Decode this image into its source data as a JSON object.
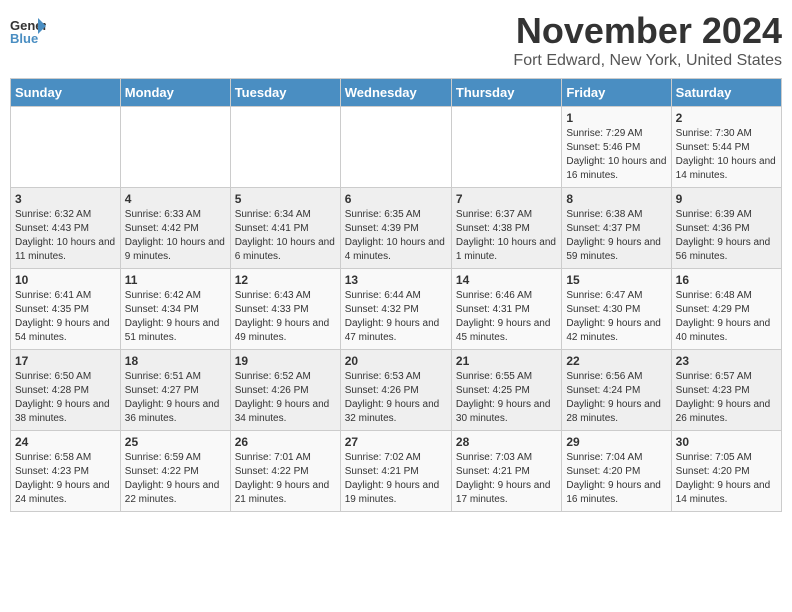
{
  "logo": {
    "line1": "General",
    "line2": "Blue"
  },
  "title": "November 2024",
  "location": "Fort Edward, New York, United States",
  "days_of_week": [
    "Sunday",
    "Monday",
    "Tuesday",
    "Wednesday",
    "Thursday",
    "Friday",
    "Saturday"
  ],
  "weeks": [
    [
      {
        "day": "",
        "info": ""
      },
      {
        "day": "",
        "info": ""
      },
      {
        "day": "",
        "info": ""
      },
      {
        "day": "",
        "info": ""
      },
      {
        "day": "",
        "info": ""
      },
      {
        "day": "1",
        "info": "Sunrise: 7:29 AM\nSunset: 5:46 PM\nDaylight: 10 hours and 16 minutes."
      },
      {
        "day": "2",
        "info": "Sunrise: 7:30 AM\nSunset: 5:44 PM\nDaylight: 10 hours and 14 minutes."
      }
    ],
    [
      {
        "day": "3",
        "info": "Sunrise: 6:32 AM\nSunset: 4:43 PM\nDaylight: 10 hours and 11 minutes."
      },
      {
        "day": "4",
        "info": "Sunrise: 6:33 AM\nSunset: 4:42 PM\nDaylight: 10 hours and 9 minutes."
      },
      {
        "day": "5",
        "info": "Sunrise: 6:34 AM\nSunset: 4:41 PM\nDaylight: 10 hours and 6 minutes."
      },
      {
        "day": "6",
        "info": "Sunrise: 6:35 AM\nSunset: 4:39 PM\nDaylight: 10 hours and 4 minutes."
      },
      {
        "day": "7",
        "info": "Sunrise: 6:37 AM\nSunset: 4:38 PM\nDaylight: 10 hours and 1 minute."
      },
      {
        "day": "8",
        "info": "Sunrise: 6:38 AM\nSunset: 4:37 PM\nDaylight: 9 hours and 59 minutes."
      },
      {
        "day": "9",
        "info": "Sunrise: 6:39 AM\nSunset: 4:36 PM\nDaylight: 9 hours and 56 minutes."
      }
    ],
    [
      {
        "day": "10",
        "info": "Sunrise: 6:41 AM\nSunset: 4:35 PM\nDaylight: 9 hours and 54 minutes."
      },
      {
        "day": "11",
        "info": "Sunrise: 6:42 AM\nSunset: 4:34 PM\nDaylight: 9 hours and 51 minutes."
      },
      {
        "day": "12",
        "info": "Sunrise: 6:43 AM\nSunset: 4:33 PM\nDaylight: 9 hours and 49 minutes."
      },
      {
        "day": "13",
        "info": "Sunrise: 6:44 AM\nSunset: 4:32 PM\nDaylight: 9 hours and 47 minutes."
      },
      {
        "day": "14",
        "info": "Sunrise: 6:46 AM\nSunset: 4:31 PM\nDaylight: 9 hours and 45 minutes."
      },
      {
        "day": "15",
        "info": "Sunrise: 6:47 AM\nSunset: 4:30 PM\nDaylight: 9 hours and 42 minutes."
      },
      {
        "day": "16",
        "info": "Sunrise: 6:48 AM\nSunset: 4:29 PM\nDaylight: 9 hours and 40 minutes."
      }
    ],
    [
      {
        "day": "17",
        "info": "Sunrise: 6:50 AM\nSunset: 4:28 PM\nDaylight: 9 hours and 38 minutes."
      },
      {
        "day": "18",
        "info": "Sunrise: 6:51 AM\nSunset: 4:27 PM\nDaylight: 9 hours and 36 minutes."
      },
      {
        "day": "19",
        "info": "Sunrise: 6:52 AM\nSunset: 4:26 PM\nDaylight: 9 hours and 34 minutes."
      },
      {
        "day": "20",
        "info": "Sunrise: 6:53 AM\nSunset: 4:26 PM\nDaylight: 9 hours and 32 minutes."
      },
      {
        "day": "21",
        "info": "Sunrise: 6:55 AM\nSunset: 4:25 PM\nDaylight: 9 hours and 30 minutes."
      },
      {
        "day": "22",
        "info": "Sunrise: 6:56 AM\nSunset: 4:24 PM\nDaylight: 9 hours and 28 minutes."
      },
      {
        "day": "23",
        "info": "Sunrise: 6:57 AM\nSunset: 4:23 PM\nDaylight: 9 hours and 26 minutes."
      }
    ],
    [
      {
        "day": "24",
        "info": "Sunrise: 6:58 AM\nSunset: 4:23 PM\nDaylight: 9 hours and 24 minutes."
      },
      {
        "day": "25",
        "info": "Sunrise: 6:59 AM\nSunset: 4:22 PM\nDaylight: 9 hours and 22 minutes."
      },
      {
        "day": "26",
        "info": "Sunrise: 7:01 AM\nSunset: 4:22 PM\nDaylight: 9 hours and 21 minutes."
      },
      {
        "day": "27",
        "info": "Sunrise: 7:02 AM\nSunset: 4:21 PM\nDaylight: 9 hours and 19 minutes."
      },
      {
        "day": "28",
        "info": "Sunrise: 7:03 AM\nSunset: 4:21 PM\nDaylight: 9 hours and 17 minutes."
      },
      {
        "day": "29",
        "info": "Sunrise: 7:04 AM\nSunset: 4:20 PM\nDaylight: 9 hours and 16 minutes."
      },
      {
        "day": "30",
        "info": "Sunrise: 7:05 AM\nSunset: 4:20 PM\nDaylight: 9 hours and 14 minutes."
      }
    ]
  ]
}
